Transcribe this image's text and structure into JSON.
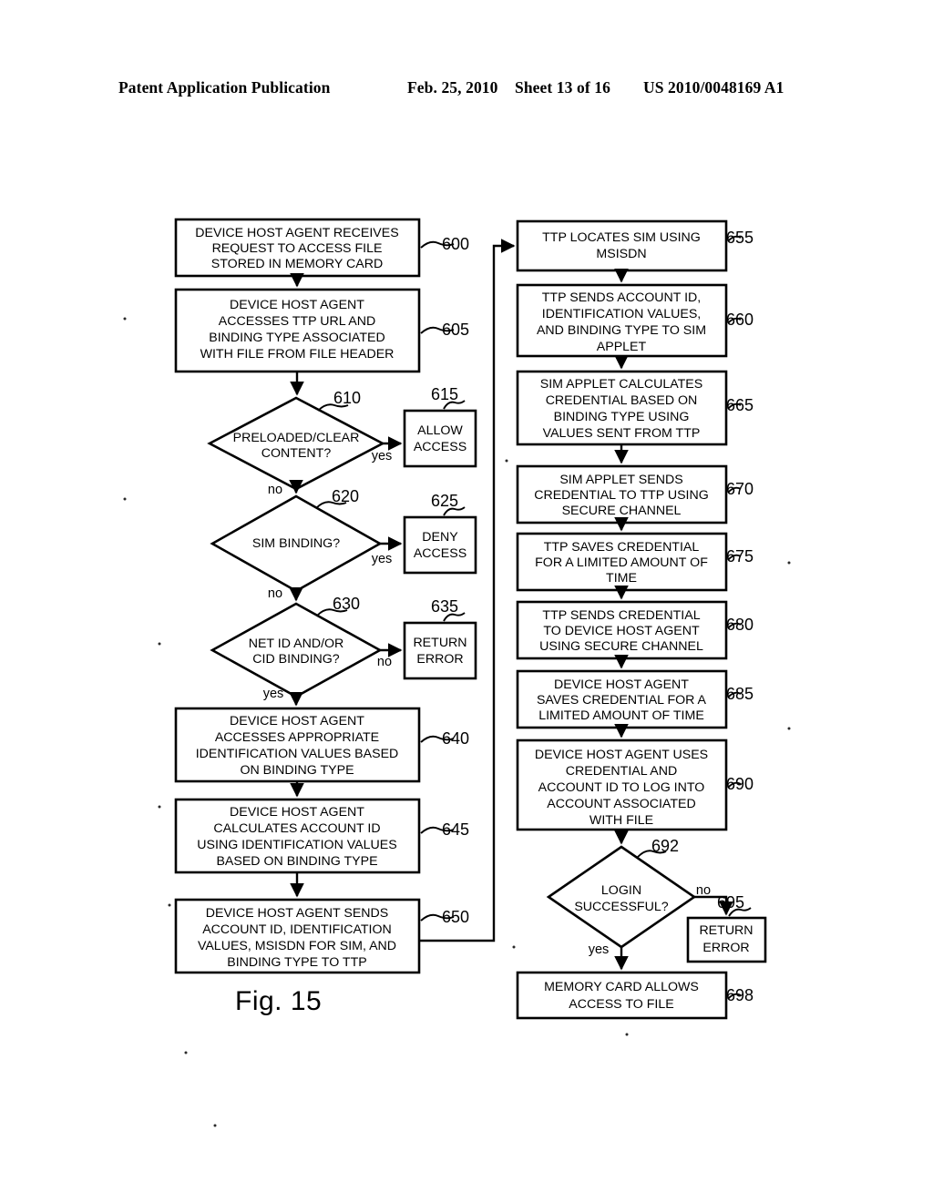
{
  "header": {
    "publication": "Patent Application Publication",
    "date": "Feb. 25, 2010",
    "sheet": "Sheet 13 of 16",
    "number": "US 2010/0048169 A1"
  },
  "figure": {
    "caption": "Fig. 15"
  },
  "chart_data": {
    "type": "diagram",
    "title": "Fig. 15",
    "nodes": [
      {
        "id": "600",
        "ref": "600",
        "shape": "process",
        "text": "DEVICE HOST AGENT RECEIVES REQUEST TO ACCESS FILE STORED IN MEMORY CARD",
        "lines": [
          "DEVICE HOST AGENT RECEIVES",
          "REQUEST TO ACCESS FILE",
          "STORED IN MEMORY CARD"
        ]
      },
      {
        "id": "605",
        "ref": "605",
        "shape": "process",
        "text": "DEVICE HOST AGENT ACCESSES TTP URL AND BINDING TYPE ASSOCIATED WITH FILE FROM FILE HEADER",
        "lines": [
          "DEVICE HOST AGENT",
          "ACCESSES TTP URL AND",
          "BINDING TYPE ASSOCIATED",
          "WITH FILE FROM FILE HEADER"
        ]
      },
      {
        "id": "610",
        "ref": "610",
        "shape": "decision",
        "text": "PRELOADED/CLEAR CONTENT?",
        "lines": [
          "PRELOADED/CLEAR",
          "CONTENT?"
        ]
      },
      {
        "id": "615",
        "ref": "615",
        "shape": "process",
        "text": "ALLOW ACCESS",
        "lines": [
          "ALLOW",
          "ACCESS"
        ]
      },
      {
        "id": "620",
        "ref": "620",
        "shape": "decision",
        "text": "SIM BINDING?",
        "lines": [
          "SIM BINDING?"
        ]
      },
      {
        "id": "625",
        "ref": "625",
        "shape": "process",
        "text": "DENY ACCESS",
        "lines": [
          "DENY",
          "ACCESS"
        ]
      },
      {
        "id": "630",
        "ref": "630",
        "shape": "decision",
        "text": "NET ID AND/OR CID BINDING?",
        "lines": [
          "NET ID AND/OR",
          "CID BINDING?"
        ]
      },
      {
        "id": "635",
        "ref": "635",
        "shape": "process",
        "text": "RETURN ERROR",
        "lines": [
          "RETURN",
          "ERROR"
        ]
      },
      {
        "id": "640",
        "ref": "640",
        "shape": "process",
        "text": "DEVICE HOST AGENT ACCESSES APPROPRIATE IDENTIFICATION VALUES BASED ON BINDING TYPE",
        "lines": [
          "DEVICE HOST AGENT",
          "ACCESSES APPROPRIATE",
          "IDENTIFICATION VALUES BASED",
          "ON BINDING TYPE"
        ]
      },
      {
        "id": "645",
        "ref": "645",
        "shape": "process",
        "text": "DEVICE HOST AGENT CALCULATES ACCOUNT ID USING IDENTIFICATION VALUES BASED ON BINDING TYPE",
        "lines": [
          "DEVICE HOST AGENT",
          "CALCULATES ACCOUNT ID",
          "USING IDENTIFICATION VALUES",
          "BASED ON BINDING TYPE"
        ]
      },
      {
        "id": "650",
        "ref": "650",
        "shape": "process",
        "text": "DEVICE HOST AGENT SENDS ACCOUNT ID, IDENTIFICATION VALUES, MSISDN FOR SIM, AND BINDING TYPE TO TTP",
        "lines": [
          "DEVICE HOST AGENT SENDS",
          "ACCOUNT ID, IDENTIFICATION",
          "VALUES, MSISDN FOR SIM, AND",
          "BINDING TYPE TO TTP"
        ]
      },
      {
        "id": "655",
        "ref": "655",
        "shape": "process",
        "text": "TTP LOCATES SIM USING MSISDN",
        "lines": [
          "TTP LOCATES SIM USING",
          "MSISDN"
        ]
      },
      {
        "id": "660",
        "ref": "660",
        "shape": "process",
        "text": "TTP SENDS ACCOUNT ID, IDENTIFICATION VALUES, AND BINDING TYPE TO SIM APPLET",
        "lines": [
          "TTP SENDS ACCOUNT ID,",
          "IDENTIFICATION VALUES,",
          "AND BINDING TYPE TO SIM",
          "APPLET"
        ]
      },
      {
        "id": "665",
        "ref": "665",
        "shape": "process",
        "text": "SIM APPLET CALCULATES CREDENTIAL BASED ON BINDING TYPE USING VALUES SENT FROM TTP",
        "lines": [
          "SIM APPLET CALCULATES",
          "CREDENTIAL BASED ON",
          "BINDING TYPE USING",
          "VALUES SENT FROM TTP"
        ]
      },
      {
        "id": "670",
        "ref": "670",
        "shape": "process",
        "text": "SIM APPLET SENDS CREDENTIAL TO TTP USING SECURE CHANNEL",
        "lines": [
          "SIM APPLET SENDS",
          "CREDENTIAL TO TTP USING",
          "SECURE CHANNEL"
        ]
      },
      {
        "id": "675",
        "ref": "675",
        "shape": "process",
        "text": "TTP SAVES CREDENTIAL FOR A LIMITED AMOUNT OF TIME",
        "lines": [
          "TTP SAVES CREDENTIAL",
          "FOR A LIMITED AMOUNT OF",
          "TIME"
        ]
      },
      {
        "id": "680",
        "ref": "680",
        "shape": "process",
        "text": "TTP SENDS CREDENTIAL TO DEVICE HOST AGENT USING SECURE CHANNEL",
        "lines": [
          "TTP SENDS CREDENTIAL",
          "TO DEVICE HOST AGENT",
          "USING SECURE CHANNEL"
        ]
      },
      {
        "id": "685",
        "ref": "685",
        "shape": "process",
        "text": "DEVICE HOST AGENT SAVES CREDENTIAL FOR A LIMITED AMOUNT OF TIME",
        "lines": [
          "DEVICE HOST AGENT",
          "SAVES CREDENTIAL FOR A",
          "LIMITED AMOUNT OF TIME"
        ]
      },
      {
        "id": "690",
        "ref": "690",
        "shape": "process",
        "text": "DEVICE HOST AGENT USES CREDENTIAL AND ACCOUNT ID TO LOG INTO ACCOUNT ASSOCIATED WITH FILE",
        "lines": [
          "DEVICE HOST AGENT USES",
          "CREDENTIAL AND",
          "ACCOUNT ID TO LOG INTO",
          "ACCOUNT ASSOCIATED",
          "WITH FILE"
        ]
      },
      {
        "id": "692",
        "ref": "692",
        "shape": "decision",
        "text": "LOGIN SUCCESSFUL?",
        "lines": [
          "LOGIN",
          "SUCCESSFUL?"
        ]
      },
      {
        "id": "695",
        "ref": "695",
        "shape": "process",
        "text": "RETURN ERROR",
        "lines": [
          "RETURN",
          "ERROR"
        ]
      },
      {
        "id": "698",
        "ref": "698",
        "shape": "process",
        "text": "MEMORY CARD ALLOWS ACCESS TO FILE",
        "lines": [
          "MEMORY CARD ALLOWS",
          "ACCESS TO FILE"
        ]
      }
    ],
    "edges": [
      {
        "from": "600",
        "to": "605",
        "label": ""
      },
      {
        "from": "605",
        "to": "610",
        "label": ""
      },
      {
        "from": "610",
        "to": "615",
        "label": "yes"
      },
      {
        "from": "610",
        "to": "620",
        "label": "no"
      },
      {
        "from": "620",
        "to": "625",
        "label": "yes"
      },
      {
        "from": "620",
        "to": "630",
        "label": "no"
      },
      {
        "from": "630",
        "to": "635",
        "label": "no"
      },
      {
        "from": "630",
        "to": "640",
        "label": "yes"
      },
      {
        "from": "640",
        "to": "645",
        "label": ""
      },
      {
        "from": "645",
        "to": "650",
        "label": ""
      },
      {
        "from": "650",
        "to": "655",
        "label": ""
      },
      {
        "from": "655",
        "to": "660",
        "label": ""
      },
      {
        "from": "660",
        "to": "665",
        "label": ""
      },
      {
        "from": "665",
        "to": "670",
        "label": ""
      },
      {
        "from": "670",
        "to": "675",
        "label": ""
      },
      {
        "from": "675",
        "to": "680",
        "label": ""
      },
      {
        "from": "680",
        "to": "685",
        "label": ""
      },
      {
        "from": "685",
        "to": "690",
        "label": ""
      },
      {
        "from": "690",
        "to": "692",
        "label": ""
      },
      {
        "from": "692",
        "to": "695",
        "label": "no"
      },
      {
        "from": "692",
        "to": "698",
        "label": "yes"
      }
    ],
    "edge_labels": {
      "yes": "yes",
      "no": "no"
    }
  }
}
